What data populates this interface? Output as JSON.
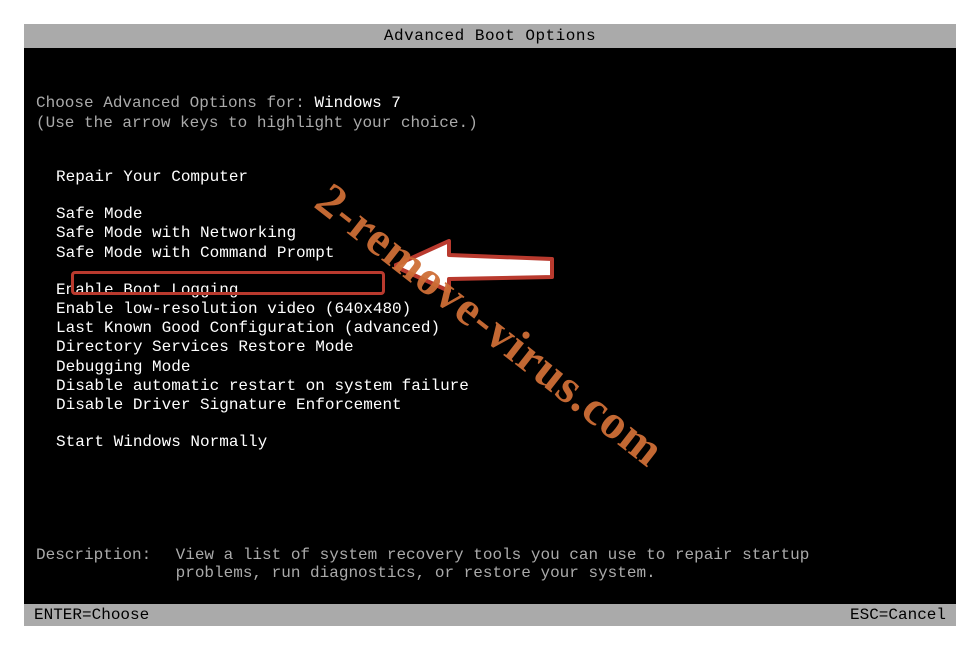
{
  "title": "Advanced Boot Options",
  "header": {
    "prefix": "Choose Advanced Options for: ",
    "os": "Windows 7",
    "instruction": "(Use the arrow keys to highlight your choice.)"
  },
  "groups": [
    [
      "Repair Your Computer"
    ],
    [
      "Safe Mode",
      "Safe Mode with Networking",
      "Safe Mode with Command Prompt"
    ],
    [
      "Enable Boot Logging",
      "Enable low-resolution video (640x480)",
      "Last Known Good Configuration (advanced)",
      "Directory Services Restore Mode",
      "Debugging Mode",
      "Disable automatic restart on system failure",
      "Disable Driver Signature Enforcement"
    ],
    [
      "Start Windows Normally"
    ]
  ],
  "highlighted_option": "Safe Mode with Command Prompt",
  "description": {
    "label": "Description:",
    "text": "View a list of system recovery tools you can use to repair startup problems, run diagnostics, or restore your system."
  },
  "footer": {
    "left": "ENTER=Choose",
    "right": "ESC=Cancel"
  },
  "watermark": "2-remove-virus.com"
}
